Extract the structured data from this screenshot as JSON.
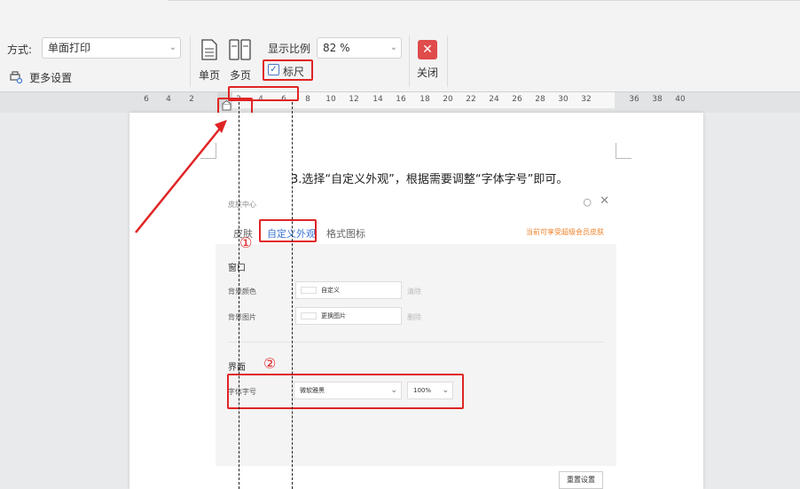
{
  "toolbar": {
    "mode_label": "方式:",
    "mode_value": "单面打印",
    "more_settings": "更多设置",
    "single_page": "单页",
    "multi_page": "多页",
    "zoom_label": "显示比例",
    "zoom_value": "82 %",
    "ruler_label": "标尺",
    "ruler_checked": true,
    "close_label": "关闭"
  },
  "ruler": {
    "ticks": [
      "6",
      "4",
      "2",
      "2",
      "4",
      "6",
      "8",
      "10",
      "12",
      "14",
      "16",
      "18",
      "20",
      "22",
      "24",
      "26",
      "28",
      "30",
      "32",
      "36",
      "38",
      "40"
    ]
  },
  "document": {
    "step_text": "3.选择“自定义外观”，根据需要调整“字体字号”即可。",
    "embed": {
      "title": "皮肤中心",
      "tabs": [
        "皮肤",
        "自定义外观",
        "格式图标"
      ],
      "member_note": "当前可享受超级会员皮肤",
      "window_section": "窗口",
      "bg_color_label": "背景颜色",
      "bg_color_value": "自定义",
      "bg_color_action": "清除",
      "bg_image_label": "背景图片",
      "bg_image_value": "更换图片",
      "bg_image_action": "删除",
      "ui_section": "界面",
      "font_label": "字体字号",
      "font_value": "微软雅黑",
      "font_size_value": "100%",
      "reset_button": "重置设置"
    },
    "markers": {
      "one": "①",
      "two": "②"
    }
  },
  "colors": {
    "highlight": "#e02424",
    "accent": "#3b75d6"
  }
}
